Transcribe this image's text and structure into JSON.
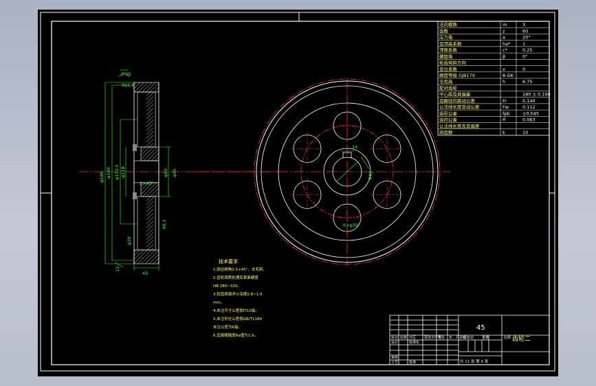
{
  "params_table": {
    "rows": [
      {
        "name": "法向模数",
        "sym": "m",
        "val": "3"
      },
      {
        "name": "齿数",
        "sym": "z",
        "val": "60"
      },
      {
        "name": "压力角",
        "sym": "a",
        "val": "20°"
      },
      {
        "name": "齿顶高系数",
        "sym": "ha*",
        "val": "1"
      },
      {
        "name": "顶隙系数",
        "sym": "c*",
        "val": "0.25"
      },
      {
        "name": "螺旋角",
        "sym": "β",
        "val": "0°"
      },
      {
        "name": "轮齿倾斜方向",
        "sym": "",
        "val": ""
      },
      {
        "name": "变位系数",
        "sym": "x",
        "val": "0"
      },
      {
        "name": "精度等级 GJB179",
        "sym": "8-GK",
        "val": ""
      },
      {
        "name": "全齿高",
        "sym": "h",
        "val": "6.75"
      },
      {
        "name": "配对齿轮",
        "sym": "",
        "val": ""
      },
      {
        "name": "中心距及其偏差",
        "sym": "",
        "val": "180 ± 0.100"
      },
      {
        "name": "齿圈径向跳动公差",
        "sym": "Fr",
        "val": "0.140"
      },
      {
        "name": "公法线长度变动公差",
        "sym": "Fw",
        "val": "0.112"
      },
      {
        "name": "齿形公差",
        "sym": "fpb",
        "val": "±0.045"
      },
      {
        "name": "齿向公差",
        "sym": "ff",
        "val": "0.063"
      },
      {
        "name": "公法线长度及其偏差",
        "sym": "",
        "val": ""
      },
      {
        "name": "跨齿数",
        "sym": "k",
        "val": "10"
      }
    ]
  },
  "tech_req": {
    "title": "技术要求",
    "lines": [
      "1.锐边倒角0.5×45°，去毛刺。",
      "2.齿轮调质处理后表面硬度",
      "HB:280~320。",
      "3.轮齿表面淬火深度0.8~1.0",
      "mm。",
      "4.未注尺寸公差按IT12级。",
      "5.未注形位公差按GB/T1184",
      "未注公差为K级。",
      "6.齿面粗糙度Ra值为1.6。"
    ]
  },
  "title_block": {
    "material": "45",
    "part_name": "齿轮二",
    "labels": [
      "标记",
      "处数",
      "分区",
      "更改文件号",
      "签名",
      "年、月、日",
      "设计",
      "标准化",
      "审核",
      "工艺",
      "批准"
    ],
    "stage_labels": [
      "阶段标记",
      "重量",
      "比例"
    ],
    "sheet": "共 11 张 第 6 张"
  },
  "dims_section": {
    "top_tol": "0.05",
    "top_ra": "Ra1.6",
    "bore": "φ45",
    "hub": "φ80",
    "root": "φ172.5",
    "tip": "φ186",
    "pitch": "φ180",
    "web": "φ118",
    "face_width": "45",
    "keyway_depth": "48.3",
    "chamfer": "2×45°",
    "hole_pattern": "φ30",
    "bottom_tol": "12"
  },
  "dims_front": {
    "keyway_width": "14",
    "bore_note": "φ45",
    "hole_note": "6×φ30"
  }
}
